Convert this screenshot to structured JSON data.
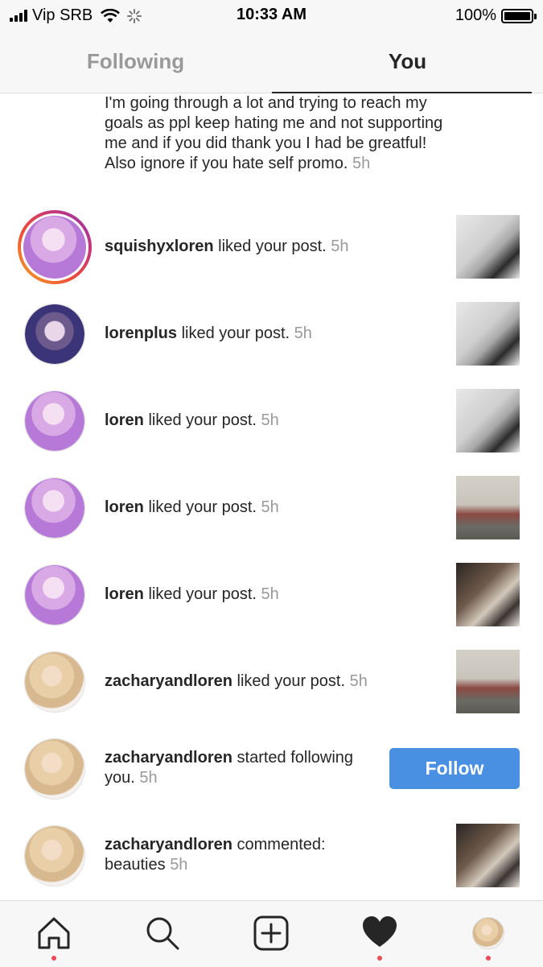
{
  "status_bar": {
    "carrier": "Vip SRB",
    "time": "10:33 AM",
    "battery": "100%"
  },
  "tabs": {
    "following": "Following",
    "you": "You",
    "active": "you"
  },
  "feed": {
    "top_comment": {
      "text": "I'm going through a lot and trying to reach my goals as ppl keep hating me and not supporting me and if you did thank you I had be greatful! Also ignore if you hate self promo.",
      "time": "5h"
    },
    "items": [
      {
        "username": "squishyxloren",
        "action": "liked your post.",
        "time": "5h"
      },
      {
        "username": "lorenplus",
        "action": "liked your post.",
        "time": "5h"
      },
      {
        "username": "loren",
        "action": "liked your post.",
        "time": "5h"
      },
      {
        "username": "loren",
        "action": "liked your post.",
        "time": "5h"
      },
      {
        "username": "loren",
        "action": "liked your post.",
        "time": "5h"
      },
      {
        "username": "zacharyandloren",
        "action": "liked your post.",
        "time": "5h"
      },
      {
        "username": "zacharyandloren",
        "action": "started following you.",
        "time": "5h",
        "button": "Follow"
      },
      {
        "username": "zacharyandloren",
        "action": "commented: beauties",
        "time": "5h"
      }
    ]
  },
  "bottom_nav": {
    "items": [
      "home-icon",
      "search-icon",
      "add-post-icon",
      "activity-heart-icon",
      "profile-avatar"
    ],
    "notification_dot_color": "#ed4956"
  },
  "colors": {
    "follow_button": "#4a90e2",
    "text": "#262626",
    "muted": "#999999"
  }
}
